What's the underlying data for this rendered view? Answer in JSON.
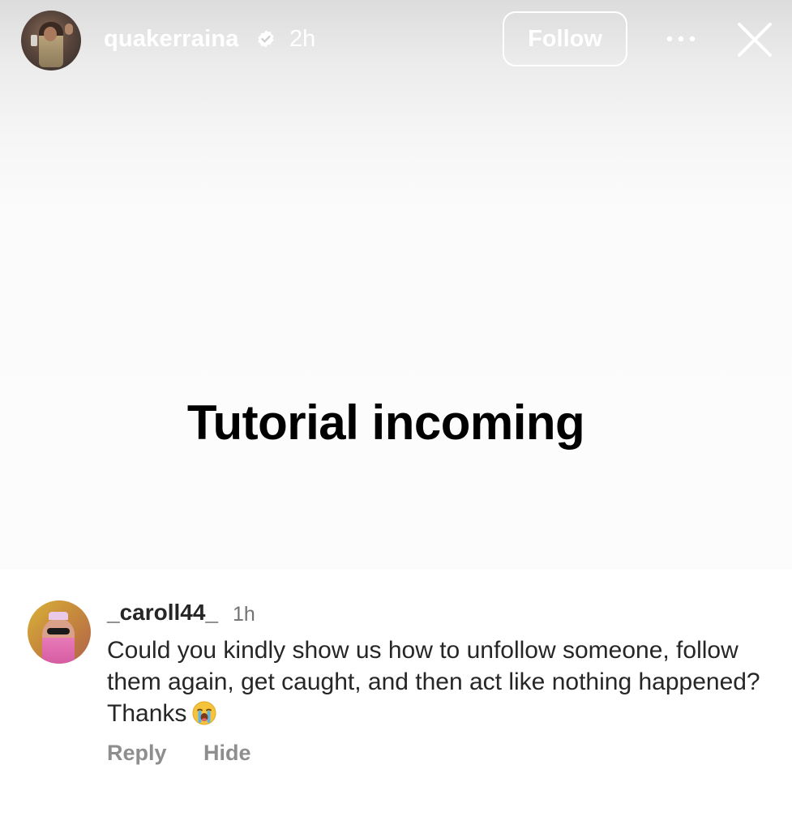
{
  "header": {
    "username": "quakerraina",
    "time": "2h",
    "follow_label": "Follow",
    "verified_icon": "verified-badge-icon",
    "more_icon": "more-options-icon",
    "close_icon": "close-icon"
  },
  "story": {
    "caption": "Tutorial incoming"
  },
  "comment": {
    "username": "_caroll44_",
    "time": "1h",
    "text": "Could you kindly show us how to unfollow someone, follow them again, get caught, and then act like nothing happened? Thanks",
    "emoji_icon": "loudly-crying-face-icon",
    "reply_label": "Reply",
    "hide_label": "Hide"
  }
}
